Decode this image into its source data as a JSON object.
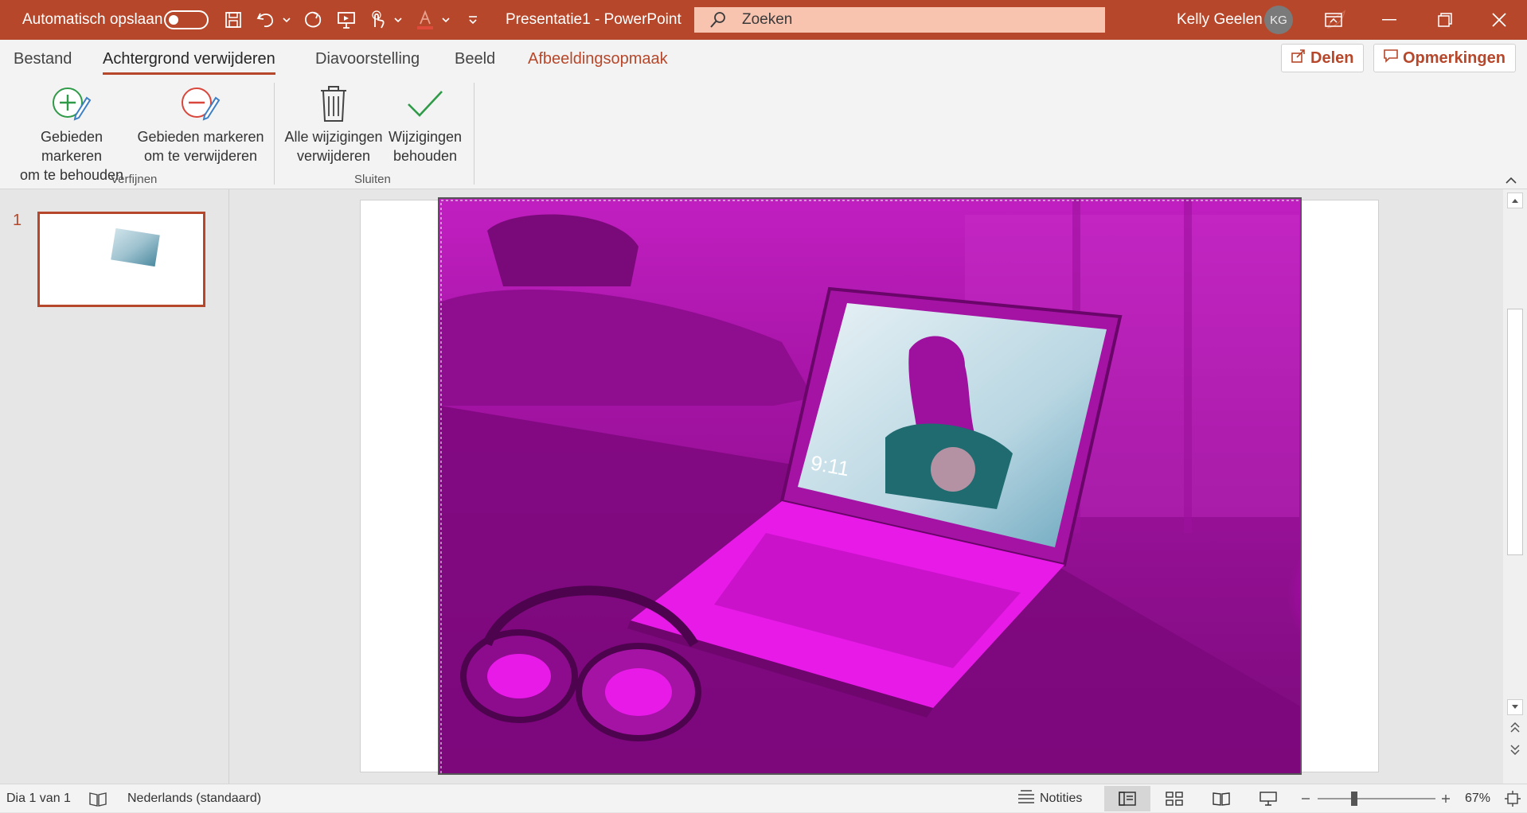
{
  "titlebar": {
    "autosave_label": "Automatisch opslaan",
    "doc_title": "Presentatie1  -  PowerPoint",
    "user_name": "Kelly Geelen",
    "user_initials": "KG"
  },
  "search": {
    "placeholder": "Zoeken"
  },
  "tabs": [
    {
      "label": "Bestand"
    },
    {
      "label": "Achtergrond verwijderen"
    },
    {
      "label": "Diavoorstelling"
    },
    {
      "label": "Beeld"
    },
    {
      "label": "Afbeeldingsopmaak"
    }
  ],
  "actions": {
    "share": "Delen",
    "comments": "Opmerkingen"
  },
  "ribbon": {
    "mark_keep": [
      "Gebieden markeren",
      "om te behouden"
    ],
    "mark_remove": [
      "Gebieden markeren",
      "om te verwijderen"
    ],
    "discard_all": [
      "Alle wijzigingen",
      "verwijderen"
    ],
    "keep_changes": [
      "Wijzigingen",
      "behouden"
    ],
    "group_refine": "Verfijnen",
    "group_close": "Sluiten"
  },
  "thumbs": {
    "slide_number": "1"
  },
  "photo_screen": {
    "time": "9:11"
  },
  "statusbar": {
    "slide_info": "Dia 1 van 1",
    "language": "Nederlands (standaard)",
    "notes": "Notities",
    "zoom": "67%"
  },
  "colors": {
    "accent": "#b7472a",
    "mask": "#c11fc1",
    "search_bg": "#f8c4b0"
  }
}
